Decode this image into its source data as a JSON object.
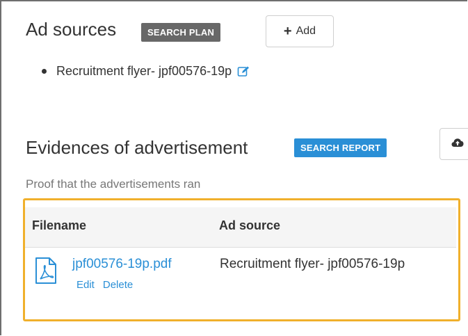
{
  "ad_sources": {
    "title": "Ad sources",
    "badge": "SEARCH PLAN",
    "add_label": "Add",
    "items": [
      {
        "label": "Recruitment flyer- jpf00576-19p"
      }
    ]
  },
  "evidences": {
    "title": "Evidences of advertisement",
    "badge": "SEARCH REPORT",
    "subtitle": "Proof that the advertisements ran",
    "columns": [
      "Filename",
      "Ad source"
    ],
    "rows": [
      {
        "filename": "jpf00576-19p.pdf",
        "actions": [
          "Edit",
          "Delete"
        ],
        "ad_source": "Recruitment flyer- jpf00576-19p"
      }
    ]
  },
  "colors": {
    "accent_blue": "#2a8fd6",
    "badge_gray": "#686868",
    "highlight": "#f0b02c"
  },
  "icons": {
    "add": "plus-icon",
    "edit": "edit-icon",
    "upload": "cloud-upload-icon",
    "file": "pdf-file-icon"
  }
}
